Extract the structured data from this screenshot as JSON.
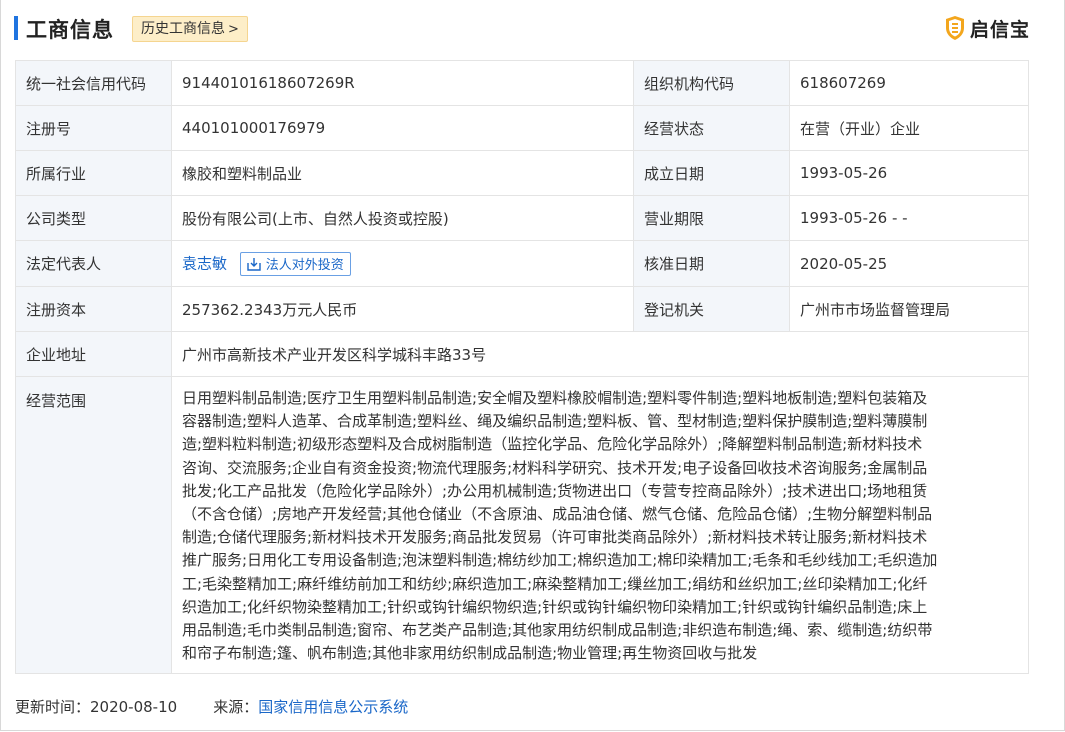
{
  "header": {
    "title": "工商信息",
    "history_label": "历史工商信息",
    "history_chevron": ">",
    "brand_name": "启信宝",
    "brand_icon": "qixinbao-shield-icon",
    "accent_color": "#1f74e0"
  },
  "rows": {
    "credit_code": {
      "label": "统一社会信用代码",
      "value": "9144010161860726​9R"
    },
    "org_code": {
      "label": "组织机构代码",
      "value": "618607269"
    },
    "reg_no": {
      "label": "注册号",
      "value": "440101000176979"
    },
    "status": {
      "label": "经营状态",
      "value": "在营（开业）企业"
    },
    "industry": {
      "label": "所属行业",
      "value": "橡胶和塑料制品业"
    },
    "founded": {
      "label": "成立日期",
      "value": "1993-05-26"
    },
    "company_type": {
      "label": "公司类型",
      "value": "股份有限公司(上市、自然人投资或控股)"
    },
    "term": {
      "label": "营业期限",
      "value": "1993-05-26 - -"
    },
    "legal_rep": {
      "label": "法定代表人",
      "value": "袁志敏",
      "invest_button": "法人对外投资",
      "invest_icon": "download-box-icon"
    },
    "approval_date": {
      "label": "核准日期",
      "value": "2020-05-25"
    },
    "capital": {
      "label": "注册资本",
      "value": "257362.2343万元人民币"
    },
    "authority": {
      "label": "登记机关",
      "value": "广州市市场监督管理局"
    },
    "address": {
      "label": "企业地址",
      "value": "广州市高新技术产业开发区科学城科丰路33号"
    },
    "scope": {
      "label": "经营范围",
      "lines": [
        "日用塑料制品制造;医疗卫生用塑料制品制造;安全帽及塑料橡胶帽制造;塑料零件制造;塑料地板制造;塑料包装箱及",
        "容器制造;塑料人造革、合成革制造;塑料丝、绳及编织品制造;塑料板、管、型材制造;塑料保护膜制造;塑料薄膜制",
        "造;塑料粒料制造;初级形态塑料及合成树脂制造（监控化学品、危险化学品除外）;降解塑料制品制造;新材料技术",
        "咨询、交流服务;企业自有资金投资;物流代理服务;材料科学研究、技术开发;电子设备回收技术咨询服务;金属制品",
        "批发;化工产品批发（危险化学品除外）;办公用机械制造;货物进出口（专营专控商品除外）;技术进出口;场地租赁",
        "（不含仓储）;房地产开发经营;其他仓储业（不含原油、成品油仓储、燃气仓储、危险品仓储）;生物分解塑料制品",
        "制造;仓储代理服务;新材料技术开发服务;商品批发贸易（许可审批类商品除外）;新材料技术转让服务;新材料技术",
        "推广服务;日用化工专用设备制造;泡沫塑料制造;棉纺纱加工;棉织造加工;棉印染精加工;毛条和毛纱线加工;毛织造加",
        "工;毛染整精加工;麻纤维纺前加工和纺纱;麻织造加工;麻染整精加工;缫丝加工;绢纺和丝织加工;丝印染精加工;化纤",
        "织造加工;化纤织物染整精加工;针织或钩针编织物织造;针织或钩针编织物印染精加工;针织或钩针编织品制造;床上",
        "用品制造;毛巾类制品制造;窗帘、布艺类产品制造;其他家用纺织制成品制造;非织造布制造;绳、索、缆制造;纺织带",
        "和帘子布制造;篷、帆布制造;其他非家用纺织制成品制造;物业管理;再生物资回收与批发"
      ]
    }
  },
  "footer": {
    "updated_label": "更新时间：2020-08-10",
    "source_label": "来源：",
    "source_link": "国家信用信息公示系统"
  }
}
